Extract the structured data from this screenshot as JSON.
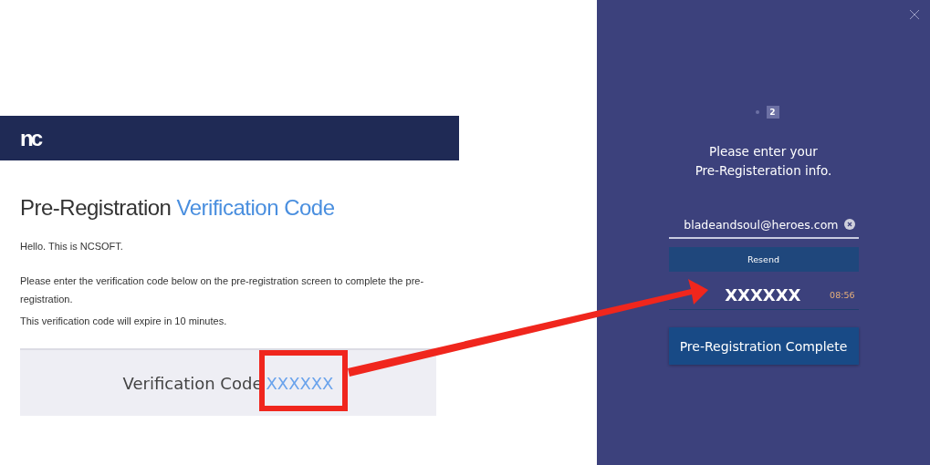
{
  "email": {
    "logo": "nc",
    "title": "Pre-Registration **Verification Code**",
    "greeting": "Hello. This is NCSOFT.",
    "instructions": [
      "Please enter the verification code below on the pre-registration screen to complete the pre-registration.",
      "This verification code will expire in 10 minutes."
    ],
    "code_label": "Verification Code",
    "code_value": "XXXXXX"
  },
  "dialog": {
    "steps": [
      {
        "selected": false
      },
      {
        "label": "2",
        "selected": true
      }
    ],
    "heading": [
      "Please enter your",
      "Pre-Registeration info."
    ],
    "email_value": "bladeandsoul@heroes.com",
    "resend_button": "Resend",
    "code_value": "XXXXXX",
    "timer": "08:56",
    "submit_button": "Pre-Registration Complete"
  }
}
